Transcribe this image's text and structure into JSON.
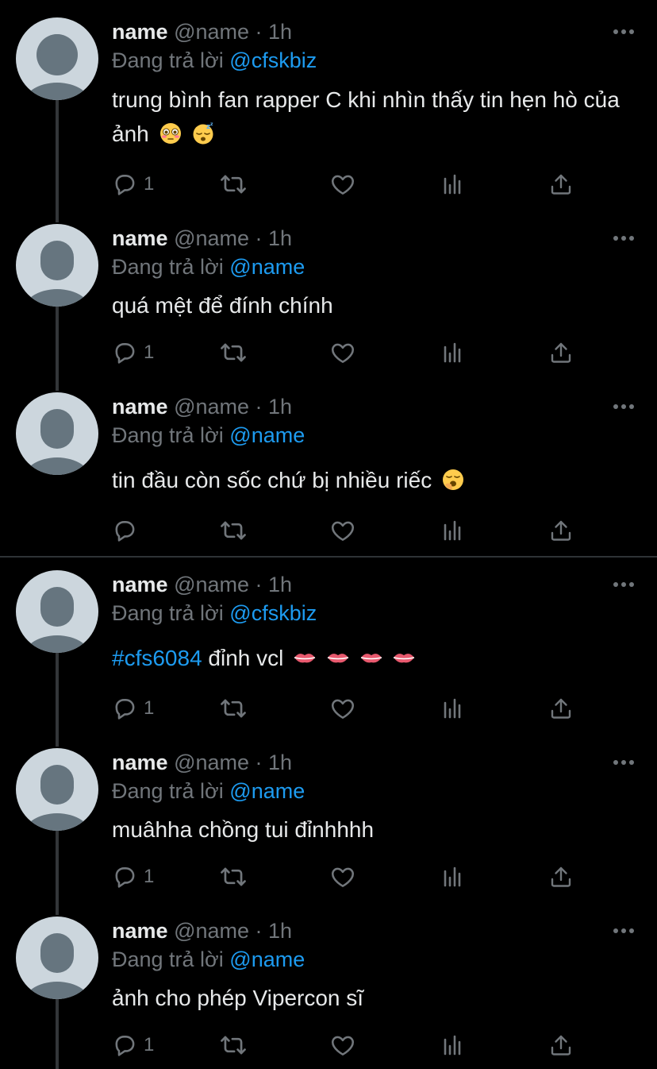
{
  "colors": {
    "background": "#000000",
    "text": "#e7e9ea",
    "muted": "#71767b",
    "link": "#1d9bf0",
    "thread_line": "#333639"
  },
  "replying_label": "Đang trả lời",
  "tweets": [
    {
      "name": "name",
      "handle": "@name",
      "time": "· 1h",
      "reply_to": "@cfskbiz",
      "text": "trung bình fan rapper C khi nhìn thấy tin hẹn hò của ảnh",
      "emojis": [
        "flushed-face",
        "sleeping-face"
      ],
      "reply_count": "1"
    },
    {
      "name": "name",
      "handle": "@name",
      "time": "· 1h",
      "reply_to": "@name",
      "text": "quá mệt để đính chính",
      "emojis": [],
      "reply_count": "1"
    },
    {
      "name": "name",
      "handle": "@name",
      "time": "· 1h",
      "reply_to": "@name",
      "text": "tin đầu còn sốc chứ bị nhiều riếc",
      "emojis": [
        "yawning-face"
      ],
      "reply_count": ""
    },
    {
      "name": "name",
      "handle": "@name",
      "time": "· 1h",
      "reply_to": "@cfskbiz",
      "hashtag": "#cfs6084",
      "text": " đỉnh vcl",
      "emojis": [
        "lips",
        "lips",
        "lips",
        "lips"
      ],
      "reply_count": "1"
    },
    {
      "name": "name",
      "handle": "@name",
      "time": "· 1h",
      "reply_to": "@name",
      "text": "muâhha chồng tui đỉnhhhh",
      "emojis": [],
      "reply_count": "1"
    },
    {
      "name": "name",
      "handle": "@name",
      "time": "· 1h",
      "reply_to": "@name",
      "text": "ảnh cho phép Vipercon sĩ",
      "emojis": [],
      "reply_count": "1"
    }
  ]
}
